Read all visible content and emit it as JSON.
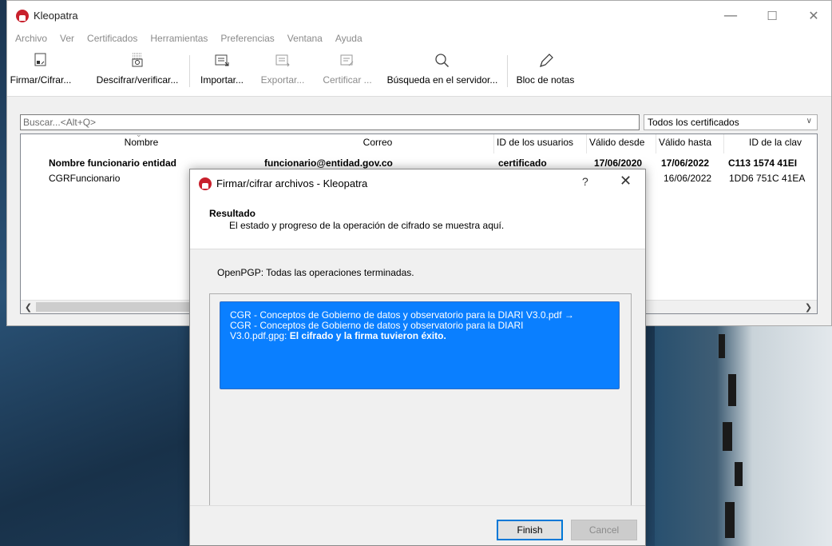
{
  "main_window": {
    "title": "Kleopatra",
    "controls": {
      "minimize": "—",
      "maximize": "☐",
      "close": "✕"
    }
  },
  "menu": [
    "Archivo",
    "Ver",
    "Certificados",
    "Herramientas",
    "Preferencias",
    "Ventana",
    "Ayuda"
  ],
  "toolbar": {
    "sign_encrypt": "Firmar/Cifrar...",
    "decrypt_verify": "Descifrar/verificar...",
    "import": "Importar...",
    "export": "Exportar...",
    "certify": "Certificar ...",
    "server_search": "Búsqueda en el servidor...",
    "notepad": "Bloc de notas"
  },
  "search": {
    "placeholder": "Buscar...<Alt+Q>",
    "filter_value": "Todos los certificados"
  },
  "table": {
    "columns": [
      "Nombre",
      "Correo",
      "ID de los usuarios",
      "Válido desde",
      "Válido hasta",
      "ID de la clav"
    ],
    "rows": [
      {
        "name": "Nombre funcionario entidad",
        "email": "funcionario@entidad.gov.co",
        "user_ids": "certificado",
        "valid_from": "17/06/2020",
        "valid_until": "17/06/2022",
        "key_id": "C113 1574 41EI"
      },
      {
        "name": "CGRFuncionario",
        "email": "",
        "user_ids": "",
        "valid_from": "",
        "valid_until": "16/06/2022",
        "key_id": "1DD6 751C 41EA"
      }
    ]
  },
  "dialog": {
    "title": "Firmar/cifrar archivos - Kleopatra",
    "help": "?",
    "close": "✕",
    "header_title": "Resultado",
    "header_subtitle": "El estado y progreso de la operación de cifrado se muestra aquí.",
    "status": "OpenPGP: Todas las operaciones terminadas.",
    "result_line1": "CGR - Conceptos de Gobierno de datos y observatorio para la DIARI V3.0.pdf →",
    "result_line2": "CGR - Conceptos de Gobierno de datos y observatorio para la DIARI",
    "result_line3": "V3.0.pdf.gpg: ",
    "result_success": "El cifrado y la firma tuvieron éxito.",
    "finish": "Finish",
    "cancel": "Cancel"
  },
  "colors": {
    "result_bg": "#0a7fff",
    "app_icon": "#c8202c",
    "default_button_border": "#0078d7"
  }
}
